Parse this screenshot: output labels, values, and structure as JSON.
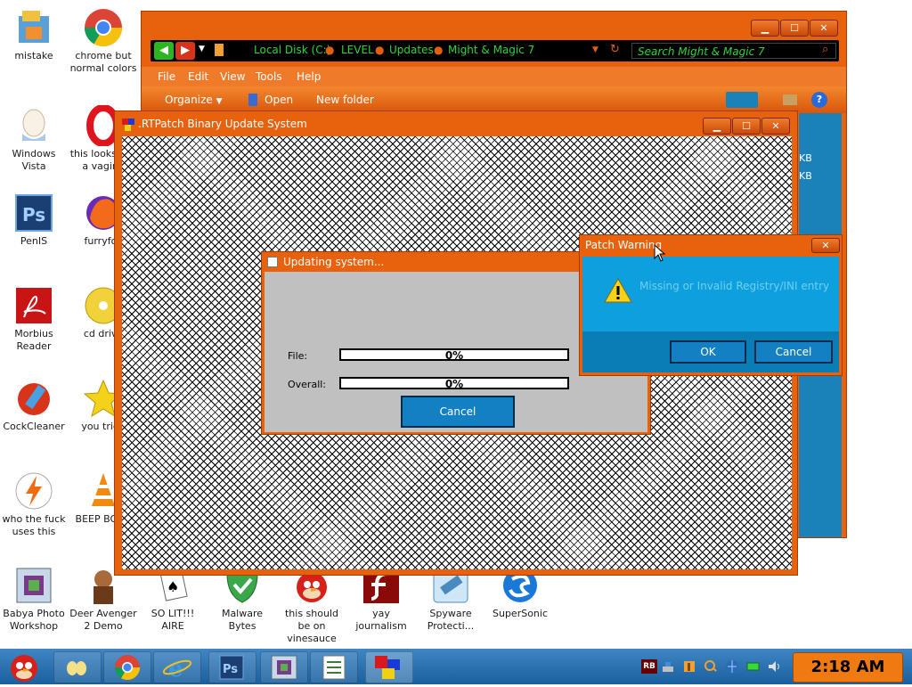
{
  "desktop_icons": [
    {
      "label": "mistake",
      "icon": "folder-icon"
    },
    {
      "label": "chrome but normal colors",
      "icon": "chrome-icon"
    },
    {
      "label": "Windows Vista",
      "icon": "egg-icon"
    },
    {
      "label": "this looks like a vagina",
      "icon": "opera-icon"
    },
    {
      "label": "PenIS",
      "icon": "photoshop-icon"
    },
    {
      "label": "furryfox",
      "icon": "firefox-icon"
    },
    {
      "label": "Morbius Reader",
      "icon": "pdf-reader-icon"
    },
    {
      "label": "cd drive",
      "icon": "cd-icon"
    },
    {
      "label": "CockCleaner",
      "icon": "ccleaner-icon"
    },
    {
      "label": "you tried",
      "icon": "star-icon"
    },
    {
      "label": "who the fuck uses this",
      "icon": "lightning-icon"
    },
    {
      "label": "BEEP BOOP",
      "icon": "vlc-icon"
    },
    {
      "label": "Babya Photo Workshop",
      "icon": "photo-workshop-icon"
    },
    {
      "label": "Deer Avenger 2 Demo",
      "icon": "deer-avenger-icon"
    },
    {
      "label": "SO LIT!!! AIRE",
      "icon": "solitaire-icon"
    },
    {
      "label": "Malware Bytes",
      "icon": "shield-icon"
    },
    {
      "label": "this should be on vinesauce",
      "icon": "angry-bird-icon"
    },
    {
      "label": "yay journalism",
      "icon": "flash-icon"
    },
    {
      "label": "Spyware Protecti...",
      "icon": "flashlight-icon"
    },
    {
      "label": "SuperSonic",
      "icon": "sonic-icon"
    }
  ],
  "explorer": {
    "breadcrumbs": [
      "Local Disk (C:)",
      "LEVEL",
      "Updates",
      "Might & Magic 7"
    ],
    "search_placeholder": "Search Might & Magic 7",
    "menu": [
      "File",
      "Edit",
      "View",
      "Tools",
      "Help"
    ],
    "toolbar": {
      "organize": "Organize",
      "open": "Open",
      "new_folder": "New folder"
    },
    "sizes": [
      "KB",
      "KB"
    ]
  },
  "rtpatch": {
    "title": ".RTPatch Binary Update System"
  },
  "updating": {
    "title": "Updating system...",
    "file_label": "File:",
    "file_pct": "0%",
    "file_progress": 0,
    "overall_label": "Overall:",
    "overall_pct": "0%",
    "overall_progress": 0,
    "cancel": "Cancel"
  },
  "warning": {
    "title": "Patch Warning",
    "message": "Missing or Invalid Registry/INI entry",
    "ok": "OK",
    "cancel": "Cancel",
    "close": "✕"
  },
  "taskbar": {
    "clock": "2:18 AM",
    "pinned": [
      "angry-bird-start-icon",
      "folder-icon",
      "chrome-icon",
      "ie-icon",
      "photoshop-icon",
      "photo-workshop-icon",
      "notepad-icon",
      "rtpatch-icon"
    ],
    "tray_rb": "RB"
  },
  "colors": {
    "window_orange": "#e8620e",
    "dialog_blue": "#0ea0de",
    "button_blue": "#1480c4",
    "taskbar_blue": "#2a72b4",
    "clock_orange": "#f07a12"
  }
}
